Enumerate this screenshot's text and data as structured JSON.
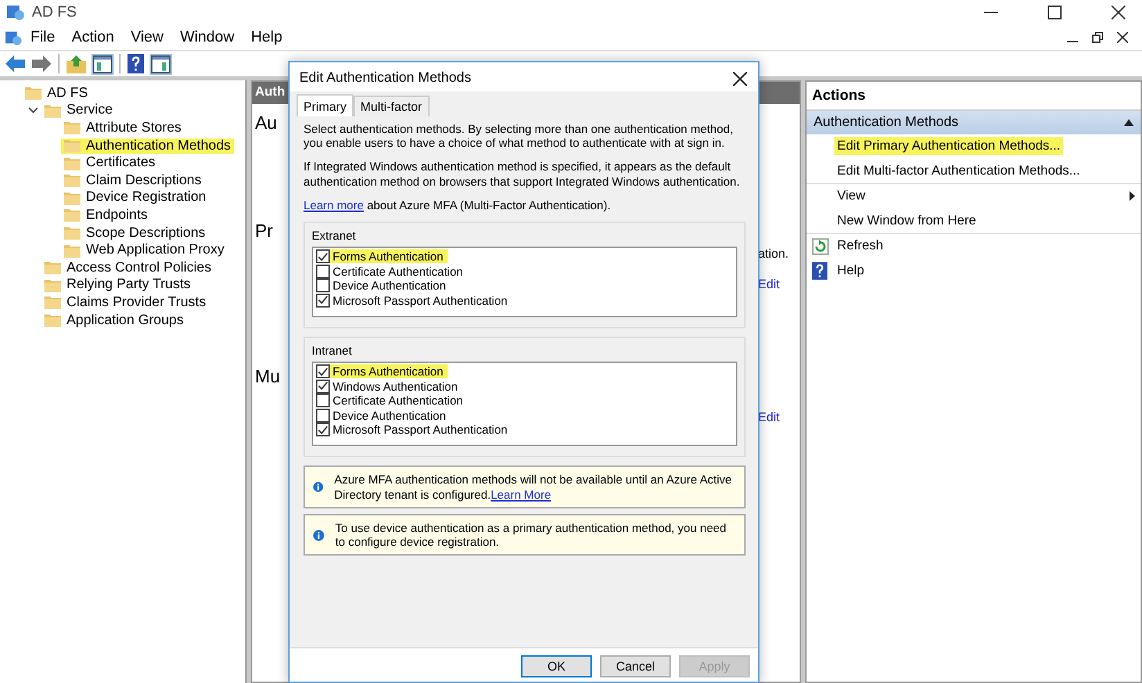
{
  "window": {
    "title": "AD FS"
  },
  "menu": [
    "File",
    "Action",
    "View",
    "Window",
    "Help"
  ],
  "tree": [
    {
      "label": "AD FS",
      "selected": false,
      "children": [
        {
          "label": "Service",
          "selected": false,
          "expanded": true,
          "children": [
            {
              "label": "Attribute Stores",
              "selected": false
            },
            {
              "label": "Authentication Methods",
              "selected": true
            },
            {
              "label": "Certificates",
              "selected": false
            },
            {
              "label": "Claim Descriptions",
              "selected": false
            },
            {
              "label": "Device Registration",
              "selected": false
            },
            {
              "label": "Endpoints",
              "selected": false
            },
            {
              "label": "Scope Descriptions",
              "selected": false
            },
            {
              "label": "Web Application Proxy",
              "selected": false
            }
          ]
        },
        {
          "label": "Access Control Policies",
          "selected": false
        },
        {
          "label": "Relying Party Trusts",
          "selected": false
        },
        {
          "label": "Claims Provider Trusts",
          "selected": false
        },
        {
          "label": "Application Groups",
          "selected": false
        }
      ]
    }
  ],
  "center": {
    "header": "Auth",
    "headings": [
      "Au",
      "Pr",
      "Mu"
    ],
    "fragment": "ation.",
    "links": [
      "Edit",
      "Edit"
    ]
  },
  "dialog": {
    "title": "Edit Authentication Methods",
    "tabs": [
      {
        "label": "Primary",
        "selected": true
      },
      {
        "label": "Multi-factor",
        "selected": false
      }
    ],
    "intro": "Select authentication methods. By selecting more than one authentication method, you enable users to have a choice of what method to authenticate with at sign in.",
    "note": "If Integrated Windows authentication method is specified, it appears as the default authentication method on browsers that support Integrated Windows authentication.",
    "learn_link": "Learn more",
    "learn_text": " about Azure MFA (Multi-Factor Authentication).",
    "groups": [
      {
        "title": "Extranet",
        "items": [
          {
            "label": "Forms Authentication",
            "checked": true,
            "highlighted": true
          },
          {
            "label": "Certificate Authentication",
            "checked": false,
            "highlighted": false
          },
          {
            "label": "Device Authentication",
            "checked": false,
            "highlighted": false
          },
          {
            "label": "Microsoft Passport Authentication",
            "checked": true,
            "highlighted": false
          }
        ]
      },
      {
        "title": "Intranet",
        "items": [
          {
            "label": "Forms Authentication",
            "checked": true,
            "highlighted": true
          },
          {
            "label": "Windows Authentication",
            "checked": true,
            "highlighted": false
          },
          {
            "label": "Certificate Authentication",
            "checked": false,
            "highlighted": false
          },
          {
            "label": "Device Authentication",
            "checked": false,
            "highlighted": false
          },
          {
            "label": "Microsoft Passport Authentication",
            "checked": true,
            "highlighted": false
          }
        ]
      }
    ],
    "infos": [
      {
        "text": "Azure MFA authentication methods will not be available until an Azure Active Directory tenant is configured.",
        "link": "Learn More"
      },
      {
        "text": "To use device authentication as a primary authentication method, you need to configure device registration."
      }
    ],
    "buttons": [
      {
        "label": "OK",
        "disabled": false,
        "default": true
      },
      {
        "label": "Cancel",
        "disabled": false,
        "default": false
      },
      {
        "label": "Apply",
        "disabled": true,
        "default": false
      }
    ]
  },
  "actions": {
    "title": "Actions",
    "section": "Authentication Methods",
    "items": [
      {
        "label": "Edit Primary Authentication Methods...",
        "kind": "plain",
        "highlighted": true
      },
      {
        "label": "Edit Multi-factor Authentication Methods...",
        "kind": "plain",
        "highlighted": false
      },
      {
        "label": "View",
        "kind": "submenu",
        "highlighted": false
      },
      {
        "label": "New Window from Here",
        "kind": "plain",
        "highlighted": false
      },
      {
        "label": "Refresh",
        "kind": "refresh",
        "highlighted": false
      },
      {
        "label": "Help",
        "kind": "help",
        "highlighted": false
      }
    ]
  }
}
